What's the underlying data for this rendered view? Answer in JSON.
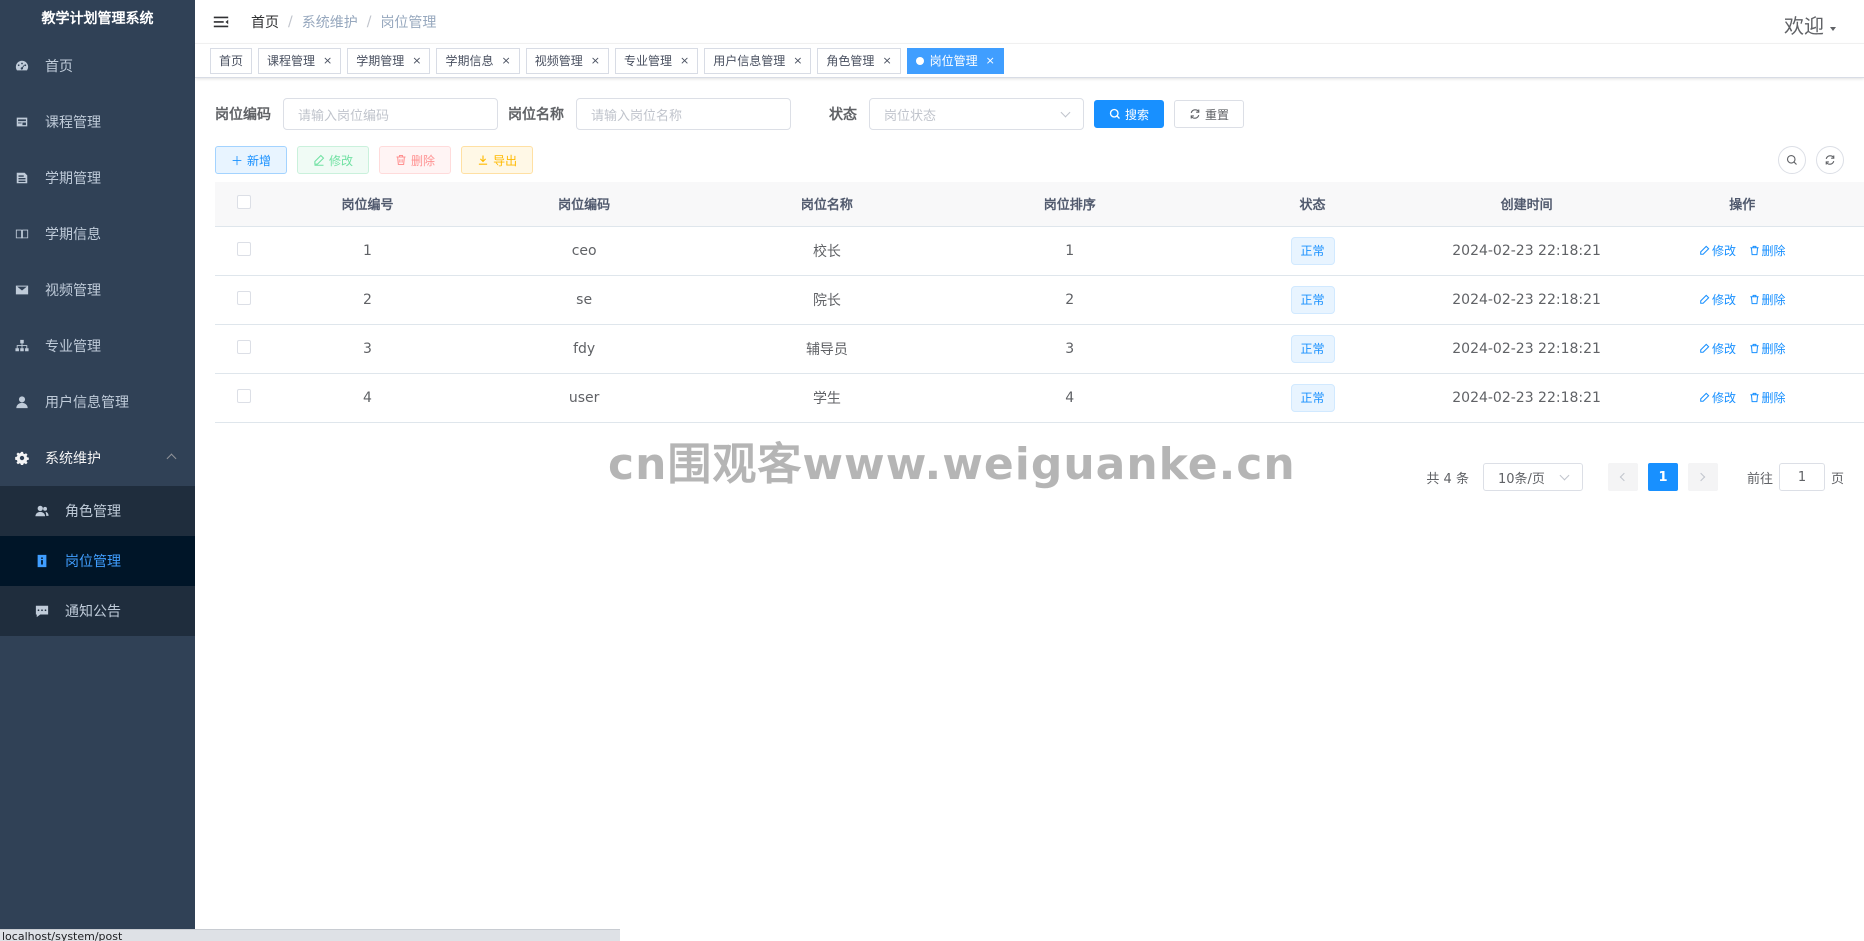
{
  "app": {
    "title": "教学计划管理系统"
  },
  "sidebar": {
    "items": [
      {
        "label": "首页",
        "icon": "dashboard-icon"
      },
      {
        "label": "课程管理",
        "icon": "course-icon"
      },
      {
        "label": "学期管理",
        "icon": "semester-icon"
      },
      {
        "label": "学期信息",
        "icon": "book-icon"
      },
      {
        "label": "视频管理",
        "icon": "mail-icon"
      },
      {
        "label": "专业管理",
        "icon": "tree-icon"
      },
      {
        "label": "用户信息管理",
        "icon": "user-icon"
      },
      {
        "label": "系统维护",
        "icon": "gear-icon"
      }
    ],
    "subitems": [
      {
        "label": "角色管理",
        "icon": "peoples-icon"
      },
      {
        "label": "岗位管理",
        "icon": "post-icon"
      },
      {
        "label": "通知公告",
        "icon": "message-icon"
      }
    ]
  },
  "navbar": {
    "breadcrumb": [
      "首页",
      "系统维护",
      "岗位管理"
    ],
    "welcome": "欢迎"
  },
  "tags": [
    "首页",
    "课程管理",
    "学期管理",
    "学期信息",
    "视频管理",
    "专业管理",
    "用户信息管理",
    "角色管理",
    "岗位管理"
  ],
  "search": {
    "code_label": "岗位编码",
    "code_placeholder": "请输入岗位编码",
    "name_label": "岗位名称",
    "name_placeholder": "请输入岗位名称",
    "status_label": "状态",
    "status_placeholder": "岗位状态",
    "search_btn": "搜索",
    "reset_btn": "重置"
  },
  "toolbar": {
    "add": "新增",
    "edit": "修改",
    "delete": "删除",
    "export": "导出"
  },
  "table": {
    "headers": [
      "岗位编号",
      "岗位编码",
      "岗位名称",
      "岗位排序",
      "状态",
      "创建时间",
      "操作"
    ],
    "rows": [
      {
        "id": "1",
        "code": "ceo",
        "name": "校长",
        "sort": "1",
        "status": "正常",
        "time": "2024-02-23 22:18:21"
      },
      {
        "id": "2",
        "code": "se",
        "name": "院长",
        "sort": "2",
        "status": "正常",
        "time": "2024-02-23 22:18:21"
      },
      {
        "id": "3",
        "code": "fdy",
        "name": "辅导员",
        "sort": "3",
        "status": "正常",
        "time": "2024-02-23 22:18:21"
      },
      {
        "id": "4",
        "code": "user",
        "name": "学生",
        "sort": "4",
        "status": "正常",
        "time": "2024-02-23 22:18:21"
      }
    ],
    "op_edit": "修改",
    "op_delete": "删除"
  },
  "pagination": {
    "total": "共 4 条",
    "page_size": "10条/页",
    "current": "1",
    "goto_prefix": "前往",
    "goto_value": "1",
    "goto_suffix": "页"
  },
  "watermark": "cn围观客www.weiguanke.cn",
  "statusbar": "localhost/system/post",
  "colors": {
    "sidebar_bg": "#304156",
    "primary": "#1890ff",
    "active_menu": "#409eff"
  }
}
